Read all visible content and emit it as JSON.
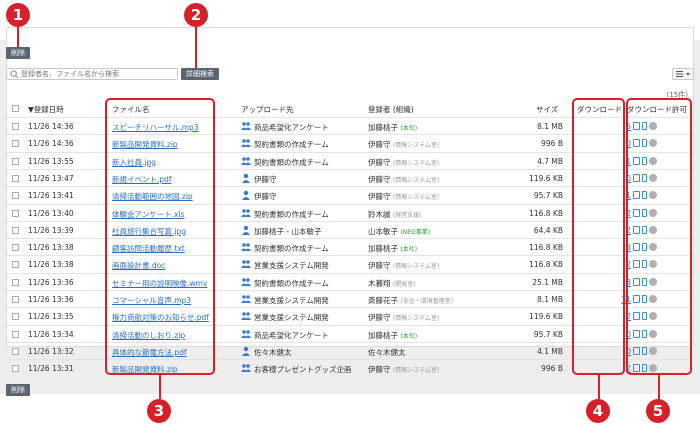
{
  "actions": {
    "delete_label": "削除",
    "advanced_search_label": "詳細検索"
  },
  "search": {
    "placeholder": "登録者名、ファイル名から検索"
  },
  "count_label": "(15件)",
  "columns": {
    "date": "▼登録日時",
    "filename": "ファイル名",
    "destination": "アップロード先",
    "registrant": "登録者 (組織)",
    "size": "サイズ",
    "downloads": "ダウンロード",
    "permission": "ダウンロード許可"
  },
  "rows": [
    {
      "date": "11/26 14:36",
      "file": "スピーチリハーサル.mp3",
      "dest": "商品希望化アンケート",
      "user": "加藤桃子",
      "org": "(本社)",
      "size": "8.1 MB",
      "dl": "5"
    },
    {
      "date": "11/26 14:36",
      "file": "新製品開発資料.zip",
      "dest": "契約書類の作成チーム",
      "user": "伊藤守",
      "org": "(情報システム室)",
      "size": "996 B",
      "dl": "0"
    },
    {
      "date": "11/26 13:55",
      "file": "新入社員.jpg",
      "dest": "契約書類の作成チーム",
      "user": "伊藤守",
      "org": "(情報システム室)",
      "size": "4.7 MB",
      "dl": "1"
    },
    {
      "date": "11/26 13:47",
      "file": "新規イベント.pdf",
      "dest": "伊藤守",
      "user": "伊藤守",
      "org": "(情報システム室)",
      "size": "119.6 KB",
      "dl": "0"
    },
    {
      "date": "11/26 13:41",
      "file": "清掃活動範囲の地図.zip",
      "dest": "伊藤守",
      "user": "伊藤守",
      "org": "(情報システム室)",
      "size": "95.7 KB",
      "dl": "1"
    },
    {
      "date": "11/26 13:40",
      "file": "体験会アンケート.xls",
      "dest": "契約書類の作成チーム",
      "user": "鈴木誠",
      "org": "(経営支援)",
      "size": "116.8 KB",
      "dl": "2"
    },
    {
      "date": "11/26 13:39",
      "file": "社員旅行集合写真.jpg",
      "dest": "加藤桃子 - 山本敏子",
      "user": "山本敏子",
      "org": "(NEO事業)",
      "size": "64.4 KB",
      "dl": "2"
    },
    {
      "date": "11/26 13:38",
      "file": "顧客訪問活動履歴.txt",
      "dest": "契約書類の作成チーム",
      "user": "加藤桃子",
      "org": "(本社)",
      "size": "116.8 KB",
      "dl": "3"
    },
    {
      "date": "11/26 13:38",
      "file": "画面設計書.doc",
      "dest": "営業支援システム開発",
      "user": "伊藤守",
      "org": "(情報システム室)",
      "size": "116.8 KB",
      "dl": "2"
    },
    {
      "date": "11/26 13:36",
      "file": "セミナー用の説明映像.wmv",
      "dest": "契約書類の作成チーム",
      "user": "木暮翔",
      "org": "(開発室)",
      "size": "25.1 MB",
      "dl": "3"
    },
    {
      "date": "11/26 13:36",
      "file": "コマーシャル音声.mp3",
      "dest": "営業支援システム開発",
      "user": "斎藤花子",
      "org": "(安全・環境管理室)",
      "size": "8.1 MB",
      "dl": "11"
    },
    {
      "date": "11/26 13:35",
      "file": "権力商航対策のお知らせ.pdf",
      "dest": "営業支援システム開発",
      "user": "伊藤守",
      "org": "(情報システム室)",
      "size": "119.6 KB",
      "dl": "2"
    },
    {
      "date": "11/26 13:34",
      "file": "清掃活動のしおり.zip",
      "dest": "商品希望化アンケート",
      "user": "加藤桃子",
      "org": "(本社)",
      "size": "95.7 KB",
      "dl": "0"
    },
    {
      "date": "11/26 13:32",
      "file": "具体的な節電方法.pdf",
      "dest": "佐々木健太",
      "user": "佐々木健太",
      "org": "",
      "size": "4.1 MB",
      "dl": "0"
    },
    {
      "date": "11/26 13:31",
      "file": "新製品開発資料.zip",
      "dest": "お客様プレゼントグッズ企画",
      "user": "伊藤守",
      "org": "(情報システム室)",
      "size": "996 B",
      "dl": "2"
    }
  ],
  "callouts": [
    "1",
    "2",
    "3",
    "4",
    "5"
  ],
  "colors": {
    "accent": "#d6202a",
    "link": "#2a6fc4",
    "button": "#5b6470"
  }
}
